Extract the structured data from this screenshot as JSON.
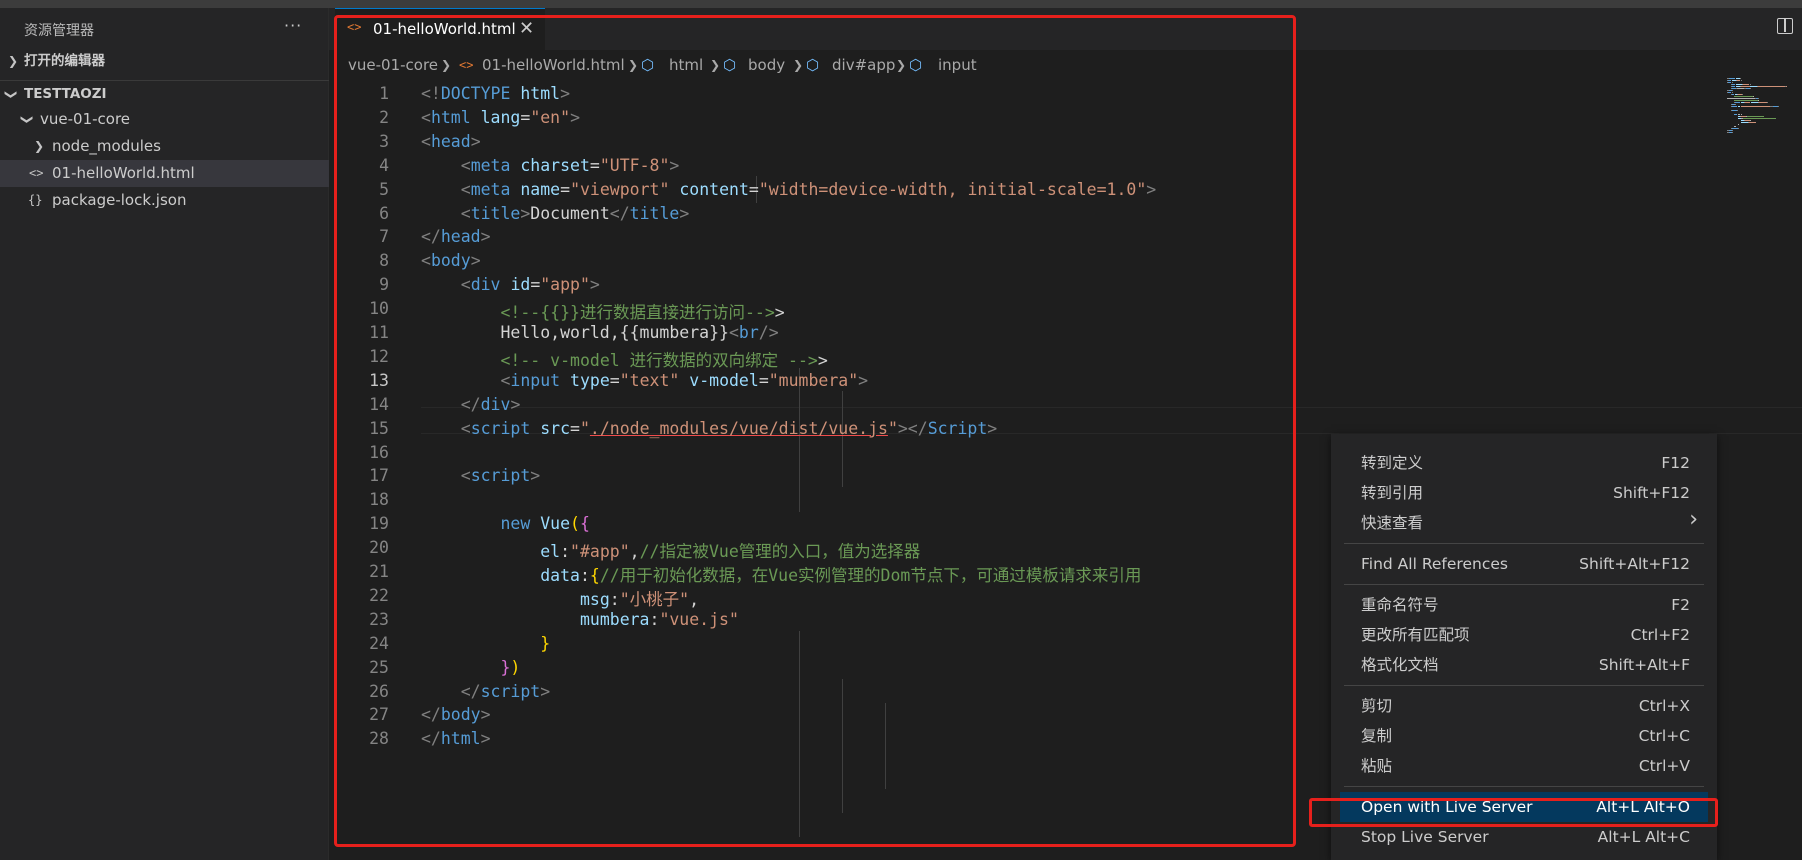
{
  "sidebar": {
    "title": "资源管理器",
    "more": "···",
    "open_editors": "打开的编辑器",
    "workspace": "TESTTAOZI",
    "folder": "vue-01-core",
    "items": [
      {
        "label": "node_modules",
        "icon": "chevron-right-icon"
      },
      {
        "label": "01-helloWorld.html",
        "icon": "html-file-icon"
      },
      {
        "label": "package-lock.json",
        "icon": "json-file-icon"
      }
    ]
  },
  "tab": {
    "label": "01-helloWorld.html",
    "close": "✕"
  },
  "breadcrumb": [
    "vue-01-core",
    "01-helloWorld.html",
    "html",
    "body",
    "div#app",
    "input"
  ],
  "editor": {
    "line_numbers": [
      "1",
      "2",
      "3",
      "4",
      "5",
      "6",
      "7",
      "8",
      "9",
      "10",
      "11",
      "12",
      "13",
      "14",
      "15",
      "16",
      "17",
      "18",
      "19",
      "20",
      "21",
      "22",
      "23",
      "24",
      "25",
      "26",
      "27",
      "28"
    ],
    "active_line": "13",
    "lines": [
      [
        [
          "pu",
          "<!"
        ],
        [
          "tg",
          "DOCTYPE"
        ],
        [
          "tx",
          " "
        ],
        [
          "at",
          "html"
        ],
        [
          "pu",
          ">"
        ]
      ],
      [
        [
          "pu",
          "<"
        ],
        [
          "tg",
          "html"
        ],
        [
          "tx",
          " "
        ],
        [
          "at",
          "lang"
        ],
        [
          "tx",
          "="
        ],
        [
          "st",
          "\"en\""
        ],
        [
          "pu",
          ">"
        ]
      ],
      [
        [
          "pu",
          "<"
        ],
        [
          "tg",
          "head"
        ],
        [
          "pu",
          ">"
        ]
      ],
      [
        [
          "tx",
          "    "
        ],
        [
          "pu",
          "<"
        ],
        [
          "tg",
          "meta"
        ],
        [
          "tx",
          " "
        ],
        [
          "at",
          "charset"
        ],
        [
          "tx",
          "="
        ],
        [
          "st",
          "\"UTF-8\""
        ],
        [
          "pu",
          ">"
        ]
      ],
      [
        [
          "tx",
          "    "
        ],
        [
          "pu",
          "<"
        ],
        [
          "tg",
          "meta"
        ],
        [
          "tx",
          " "
        ],
        [
          "at",
          "name"
        ],
        [
          "tx",
          "="
        ],
        [
          "st",
          "\"viewport\""
        ],
        [
          "tx",
          " "
        ],
        [
          "at",
          "content"
        ],
        [
          "tx",
          "="
        ],
        [
          "st",
          "\"width=device-width, initial-scale=1.0\""
        ],
        [
          "pu",
          ">"
        ]
      ],
      [
        [
          "tx",
          "    "
        ],
        [
          "pu",
          "<"
        ],
        [
          "tg",
          "title"
        ],
        [
          "pu",
          ">"
        ],
        [
          "tx",
          "Document"
        ],
        [
          "pu",
          "</"
        ],
        [
          "tg",
          "title"
        ],
        [
          "pu",
          ">"
        ]
      ],
      [
        [
          "pu",
          "</"
        ],
        [
          "tg",
          "head"
        ],
        [
          "pu",
          ">"
        ]
      ],
      [
        [
          "pu",
          "<"
        ],
        [
          "tg",
          "body"
        ],
        [
          "pu",
          ">"
        ]
      ],
      [
        [
          "tx",
          "    "
        ],
        [
          "pu",
          "<"
        ],
        [
          "tg",
          "div"
        ],
        [
          "tx",
          " "
        ],
        [
          "at",
          "id"
        ],
        [
          "tx",
          "="
        ],
        [
          "st",
          "\"app\""
        ],
        [
          "pu",
          ">"
        ]
      ],
      [
        [
          "tx",
          "        "
        ],
        [
          "cm",
          "<!--{{}}进行数据直接进行访问-->"
        ],
        [
          "tx",
          ">"
        ]
      ],
      [
        [
          "tx",
          "        Hello,world,{{mumbera}}"
        ],
        [
          "pu",
          "<"
        ],
        [
          "tg",
          "br"
        ],
        [
          "pu",
          "/>"
        ]
      ],
      [
        [
          "tx",
          "        "
        ],
        [
          "cm",
          "<!-- v-model 进行数据的双向绑定 -->"
        ],
        [
          "tx",
          ">"
        ]
      ],
      [
        [
          "tx",
          "        "
        ],
        [
          "pu",
          "<"
        ],
        [
          "tg",
          "input"
        ],
        [
          "tx",
          " "
        ],
        [
          "at",
          "type"
        ],
        [
          "tx",
          "="
        ],
        [
          "st",
          "\"text\""
        ],
        [
          "tx",
          " "
        ],
        [
          "at",
          "v-model"
        ],
        [
          "tx",
          "="
        ],
        [
          "st",
          "\"mumbera\""
        ],
        [
          "pu",
          ">"
        ]
      ],
      [
        [
          "tx",
          "    "
        ],
        [
          "pu",
          "</"
        ],
        [
          "tg",
          "div"
        ],
        [
          "pu",
          ">"
        ]
      ],
      [
        [
          "tx",
          "    "
        ],
        [
          "pu",
          "<"
        ],
        [
          "tg",
          "script"
        ],
        [
          "tx",
          " "
        ],
        [
          "at",
          "src"
        ],
        [
          "tx",
          "="
        ],
        [
          "st",
          "\""
        ],
        [
          "stu",
          "./node_modules/vue/dist/vue.js"
        ],
        [
          "st",
          "\""
        ],
        [
          "pu",
          "></"
        ],
        [
          "tg",
          "Script"
        ],
        [
          "pu",
          ">"
        ]
      ],
      [
        [
          "tx",
          ""
        ]
      ],
      [
        [
          "tx",
          "    "
        ],
        [
          "pu",
          "<"
        ],
        [
          "tg",
          "script"
        ],
        [
          "pu",
          ">"
        ]
      ],
      [
        [
          "tx",
          ""
        ]
      ],
      [
        [
          "tx",
          "        "
        ],
        [
          "tg",
          "new"
        ],
        [
          "tx",
          " "
        ],
        [
          "ty",
          "Vue"
        ],
        [
          "br",
          "("
        ],
        [
          "br2",
          "{"
        ]
      ],
      [
        [
          "tx",
          "            "
        ],
        [
          "at",
          "el"
        ],
        [
          "tx",
          ":"
        ],
        [
          "st",
          "\"#app\""
        ],
        [
          "tx",
          ","
        ],
        [
          "cm",
          "//指定被Vue管理的入口，值为选择器"
        ]
      ],
      [
        [
          "tx",
          "            "
        ],
        [
          "at",
          "data"
        ],
        [
          "tx",
          ":"
        ],
        [
          "br",
          "{"
        ],
        [
          "cm",
          "//用于初始化数据，在Vue实例管理的Dom节点下，可通过模板请求来引用"
        ]
      ],
      [
        [
          "tx",
          "                "
        ],
        [
          "at",
          "msg"
        ],
        [
          "tx",
          ":"
        ],
        [
          "st",
          "\"小桃子\""
        ],
        [
          "tx",
          ","
        ]
      ],
      [
        [
          "tx",
          "                "
        ],
        [
          "at",
          "mumbera"
        ],
        [
          "tx",
          ":"
        ],
        [
          "st",
          "\"vue.js\""
        ]
      ],
      [
        [
          "tx",
          "            "
        ],
        [
          "br",
          "}"
        ]
      ],
      [
        [
          "tx",
          "        "
        ],
        [
          "br2",
          "}"
        ],
        [
          "br",
          ")"
        ]
      ],
      [
        [
          "tx",
          "    "
        ],
        [
          "pu",
          "</"
        ],
        [
          "tg",
          "script"
        ],
        [
          "pu",
          ">"
        ]
      ],
      [
        [
          "pu",
          "</"
        ],
        [
          "tg",
          "body"
        ],
        [
          "pu",
          ">"
        ]
      ],
      [
        [
          "pu",
          "</"
        ],
        [
          "tg",
          "html"
        ],
        [
          "pu",
          ">"
        ]
      ]
    ]
  },
  "context_menu": {
    "groups": [
      [
        {
          "label": "转到定义",
          "key": "F12"
        },
        {
          "label": "转到引用",
          "key": "Shift+F12"
        },
        {
          "label": "快速查看",
          "key": "›"
        }
      ],
      [
        {
          "label": "Find All References",
          "key": "Shift+Alt+F12"
        }
      ],
      [
        {
          "label": "重命名符号",
          "key": "F2"
        },
        {
          "label": "更改所有匹配项",
          "key": "Ctrl+F2"
        },
        {
          "label": "格式化文档",
          "key": "Shift+Alt+F"
        }
      ],
      [
        {
          "label": "剪切",
          "key": "Ctrl+X"
        },
        {
          "label": "复制",
          "key": "Ctrl+C"
        },
        {
          "label": "粘贴",
          "key": "Ctrl+V"
        }
      ],
      [
        {
          "label": "Open with Live Server",
          "key": "Alt+L Alt+O",
          "selected": true
        },
        {
          "label": "Stop Live Server",
          "key": "Alt+L Alt+C"
        }
      ]
    ]
  },
  "colors": {
    "highlight_box": "#e6201c",
    "menu_selected": "#04395e",
    "accent": "#007acc"
  }
}
